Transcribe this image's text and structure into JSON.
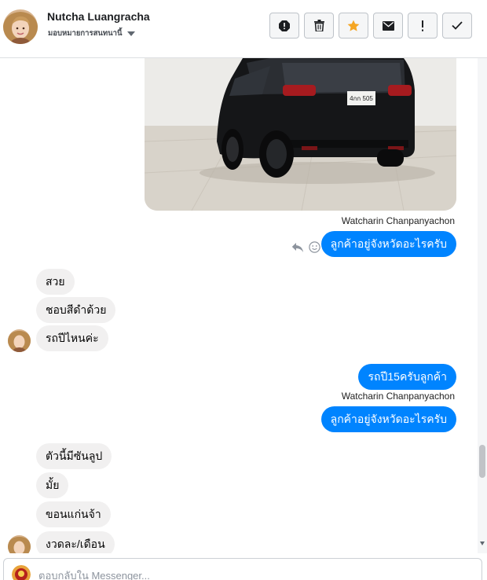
{
  "header": {
    "contact_name": "Nutcha Luangracha",
    "assign_label": "มอบหมายการสนทนานี้",
    "toolbar": [
      {
        "icon": "report-icon",
        "name": "report-button"
      },
      {
        "icon": "trash-icon",
        "name": "delete-button"
      },
      {
        "icon": "star-icon",
        "name": "star-button"
      },
      {
        "icon": "envelope-icon",
        "name": "mark-unread-button"
      },
      {
        "icon": "exclamation-icon",
        "name": "follow-up-button"
      },
      {
        "icon": "check-icon",
        "name": "mark-done-button"
      }
    ]
  },
  "conversation": {
    "photo": {
      "plate": "4กก 505"
    },
    "outgoing_1": {
      "sender": "Watcharin Chanpanyachon",
      "text": "ลูกค้าอยู่จังหวัดอะไรครับ"
    },
    "incoming_group_1": [
      "สวย",
      "ชอบสีดำด้วย",
      "รถปีไหนค่ะ"
    ],
    "outgoing_2": {
      "text": "รถปี15ครับลูกค้า"
    },
    "outgoing_3": {
      "sender": "Watcharin Chanpanyachon",
      "text": "ลูกค้าอยู่จังหวัดอะไรครับ"
    },
    "incoming_group_2": [
      "ตัวนี้มีซันลูป",
      "มั้ย",
      "ขอนแก่นจ้า",
      "งวดละ/เดือน"
    ]
  },
  "composer": {
    "placeholder": "ตอบกลับใน Messenger..."
  },
  "colors": {
    "accent": "#0084ff",
    "incoming_bubble": "#f1f0f0",
    "star": "#f5a623"
  }
}
